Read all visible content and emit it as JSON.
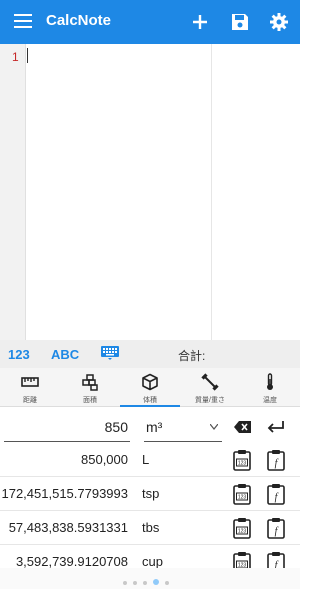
{
  "appbar": {
    "title": "CalcNote",
    "icons": [
      "menu-icon",
      "add-icon",
      "save-icon",
      "settings-gear-icon"
    ]
  },
  "editor": {
    "line_number": "1"
  },
  "modebar": {
    "numeric": "123",
    "alpha": "ABC",
    "sum_label": "合計:"
  },
  "tabs": [
    {
      "label": "距離",
      "icon": "ruler-icon"
    },
    {
      "label": "面積",
      "icon": "area-blocks-icon"
    },
    {
      "label": "体積",
      "icon": "cube-icon"
    },
    {
      "label": "質量/重さ",
      "icon": "weight-icon"
    },
    {
      "label": "温度",
      "icon": "thermometer-icon"
    }
  ],
  "converter": {
    "input_value": "850",
    "input_unit": "m³",
    "results": [
      {
        "value": "850,000",
        "unit": "L"
      },
      {
        "value": "172,451,515.7793993",
        "unit": "tsp"
      },
      {
        "value": "57,483,838.5931331",
        "unit": "tbs"
      },
      {
        "value": "3,592,739.9120708",
        "unit": "cup"
      }
    ]
  },
  "colors": {
    "accent": "#1e88e5",
    "line_number": "#c62828"
  }
}
